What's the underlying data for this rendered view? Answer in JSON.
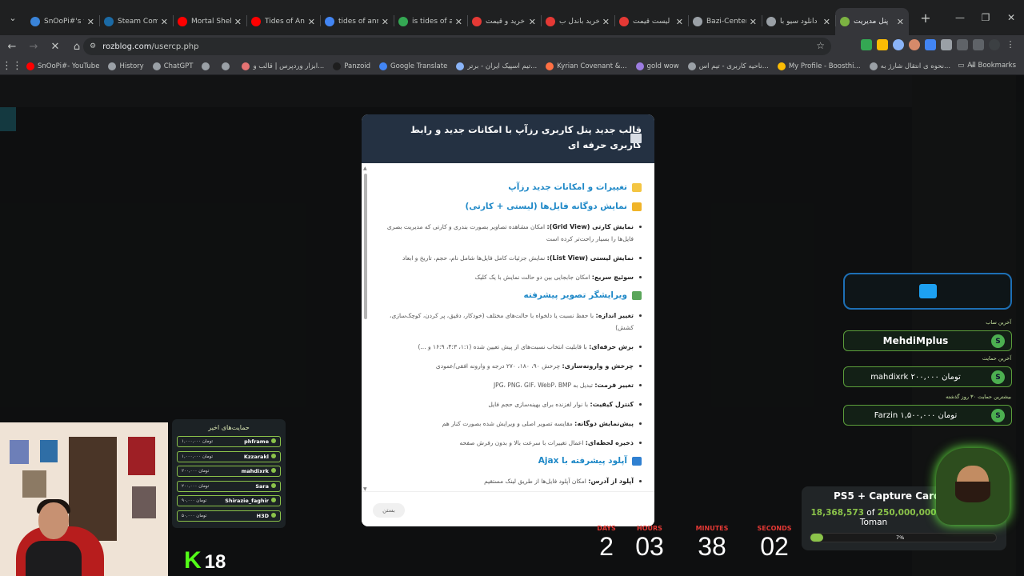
{
  "tabs": [
    {
      "title": "SnOoPi#'s w",
      "color": "#3a84d9",
      "active": false
    },
    {
      "title": "Steam Comm",
      "color": "#1b6aa5",
      "active": false
    },
    {
      "title": "Mortal Shell",
      "color": "#ff0000",
      "active": false
    },
    {
      "title": "Tides of Ann",
      "color": "#ff0000",
      "active": false
    },
    {
      "title": "tides of ann",
      "color": "#4285f4",
      "active": false
    },
    {
      "title": "is tides of ar",
      "color": "#34a853",
      "active": false
    },
    {
      "title": "خرید و قیمت",
      "color": "#e53935",
      "active": false
    },
    {
      "title": "خرید باندل ب",
      "color": "#e53935",
      "active": false
    },
    {
      "title": "لیست قیمت",
      "color": "#e53935",
      "active": false
    },
    {
      "title": "Bazi-Center",
      "color": "#9aa0a6",
      "active": false
    },
    {
      "title": "دانلود سیو با",
      "color": "#9aa0a6",
      "active": false
    },
    {
      "title": "پنل مدیریت",
      "color": "#7cb342",
      "active": true
    }
  ],
  "address": {
    "host": "rozblog.com",
    "path": "/usercp.php"
  },
  "bookmarks": [
    "SnOoPi#- YouTube",
    "History",
    "ChatGPT",
    "",
    "",
    "ابزار وردپرس | قالب و...",
    "Panzoid",
    "Google Translate",
    "تیم اسپیک ایران - برتر...",
    "Kyrian Covenant &...",
    "gold wow",
    "ناحیه کاربری - تیم اس...",
    "My Profile - Boosthi...",
    "نحوه ی انتقال شارژ به...",
    "»"
  ],
  "all_bookmarks": "All Bookmarks",
  "modal": {
    "title": "قالب جدید پنل کاربری رزآپ با امکانات جدید و رابط کاربری حرفه ای",
    "sections": [
      {
        "heading": "تغییرات و امکانات جدید رزآپ",
        "emoji_color": "#f4c542",
        "items": []
      },
      {
        "heading": "نمایش دوگانه فایل‌ها (لیستی + کارتی)",
        "emoji_color": "#f0b429",
        "items": [
          {
            "bold": "نمایش کارتی (Grid View):",
            "text": " امکان مشاهده تصاویر بصورت بندری و کارتی که مدیریت بصری فایل‌ها را بسیار راحت‌تر کرده است"
          },
          {
            "bold": "نمایش لیستی (List View):",
            "text": " نمایش جزئیات کامل فایل‌ها شامل نام، حجم، تاریخ و ابعاد"
          },
          {
            "bold": "سوئیچ سریع:",
            "text": " امکان جابجایی بین دو حالت نمایش با یک کلیک"
          }
        ]
      },
      {
        "heading": "ویرایشگر تصویر پیشرفته",
        "emoji_color": "#5aa65a",
        "items": [
          {
            "bold": "تغییر اندازه:",
            "text": " با حفظ نسبت یا دلخواه با حالت‌های مختلف (خودکار، دقیق، پر کردن، کوچک‌سازی، کشش)"
          },
          {
            "bold": "برش حرفه‌ای:",
            "text": " با قابلیت انتخاب نسبت‌های از پیش تعیین شده (۱:۱، ۴:۳، ۱۶:۹ و ...)"
          },
          {
            "bold": "چرخش و وارونه‌سازی:",
            "text": " چرخش ۹۰، ۱۸۰، ۲۷۰ درجه و وارونه افقی/عمودی"
          },
          {
            "bold": "تغییر فرمت:",
            "text": " تبدیل به JPG، PNG، GIF، WebP، BMP"
          },
          {
            "bold": "کنترل کیفیت:",
            "text": " با نوار لغزنده برای بهینه‌سازی حجم فایل"
          },
          {
            "bold": "پیش‌نمایش دوگانه:",
            "text": " مقایسه تصویر اصلی و ویرایش شده بصورت کنار هم"
          },
          {
            "bold": "ذخیره لحظه‌ای:",
            "text": " اعمال تغییرات با سرعت بالا و بدون رفرش صفحه"
          }
        ]
      },
      {
        "heading": "آپلود پیشرفته با Ajax",
        "emoji_color": "#2f80d1",
        "items": [
          {
            "bold": "آپلود از آدرس:",
            "text": " امکان آپلود فایل‌ها از طریق لینک مستقیم"
          }
        ]
      }
    ],
    "close_label": "بستن"
  },
  "supporters": {
    "title": "حمایت‌های اخیر",
    "rows": [
      {
        "name": "phframe",
        "amount": "۱,۰۰۰,۰۰۰ تومان"
      },
      {
        "name": "Kzzarakl",
        "amount": "۱,۰۰۰,۰۰۰ تومان"
      },
      {
        "name": "mahdixrk",
        "amount": "۲۰۰,۰۰۰ تومان"
      },
      {
        "name": "Sara",
        "amount": "۲۰۰,۰۰۰ تومان"
      },
      {
        "name": "Shirazie_faghir",
        "amount": "۹۰,۰۰۰ تومان"
      },
      {
        "name": "H3D",
        "amount": "۵۰,۰۰۰ تومان"
      }
    ]
  },
  "kick": {
    "letter": "K",
    "count": "18"
  },
  "timer": {
    "labels": [
      "DAYS",
      "HOURS",
      "MINUTES",
      "SECONDS"
    ],
    "values": [
      "2",
      "03",
      "38",
      "02"
    ]
  },
  "right": {
    "last_sub_label": "آخرین ساب",
    "last_sub": "MehdiMplus",
    "last_support_label": "آخرین حمایت",
    "last_support": "mahdixrk ۲۰۰,۰۰۰ تومان",
    "top_support_label": "بیشترین حمایت ۳۰ روز گذشته",
    "top_support": "Farzin ۱,۵۰۰,۰۰۰ تومان",
    "coin_symbol": "S"
  },
  "goal": {
    "title": "PS5 + Capture Card",
    "current": "18,368,573",
    "of": "of",
    "target": "250,000,000",
    "unit": "Toman",
    "percent_label": "7%",
    "progress": 0.07
  }
}
